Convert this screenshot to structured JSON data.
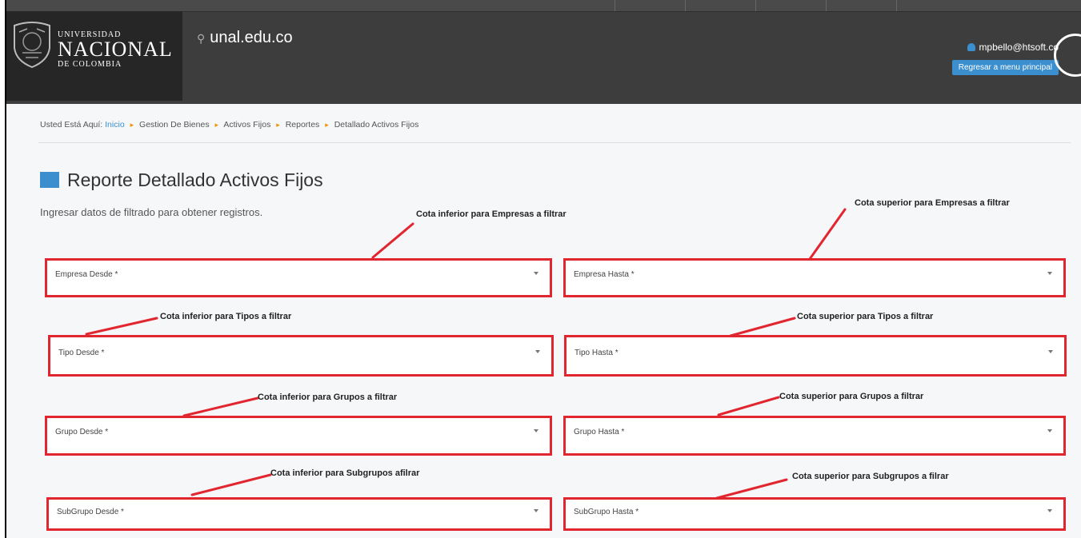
{
  "header": {
    "logo": {
      "line1": "UNIVERSIDAD",
      "line2": "NACIONAL",
      "line3": "DE COLOMBIA"
    },
    "site": "unal.edu.co",
    "user": "mpbello@htsoft.co",
    "back_button": "Regresar a menu principal"
  },
  "breadcrumb": {
    "prefix": "Usted Está Aquí:",
    "items": [
      "Inicio",
      "Gestion De Bienes",
      "Activos Fijos",
      "Reportes",
      "Detallado Activos Fijos"
    ]
  },
  "page": {
    "title": "Reporte Detallado Activos Fijos",
    "intro": "Ingresar datos de filtrado para obtener registros."
  },
  "fields": [
    {
      "label": "Empresa Desde *"
    },
    {
      "label": "Empresa Hasta *"
    },
    {
      "label": "Tipo Desde *"
    },
    {
      "label": "Tipo Hasta *"
    },
    {
      "label": "Grupo Desde *"
    },
    {
      "label": "Grupo Hasta *"
    },
    {
      "label": "SubGrupo Desde *"
    },
    {
      "label": "SubGrupo Hasta *"
    }
  ],
  "annotations": [
    "Cota inferior para Empresas a filtrar",
    "Cota superior para Empresas a filtrar",
    "Cota inferior para Tipos a filtrar",
    "Cota superior para Tipos a filtrar",
    "Cota inferior para Grupos a filtrar",
    "Cota superior para Grupos a filtrar",
    "Cota inferior para Subgrupos afilrar",
    "Cota superior para Subgrupos a filrar"
  ],
  "colors": {
    "accent": "#3b8fcf",
    "annotation": "#e2262f",
    "header": "#3d3d3d"
  }
}
